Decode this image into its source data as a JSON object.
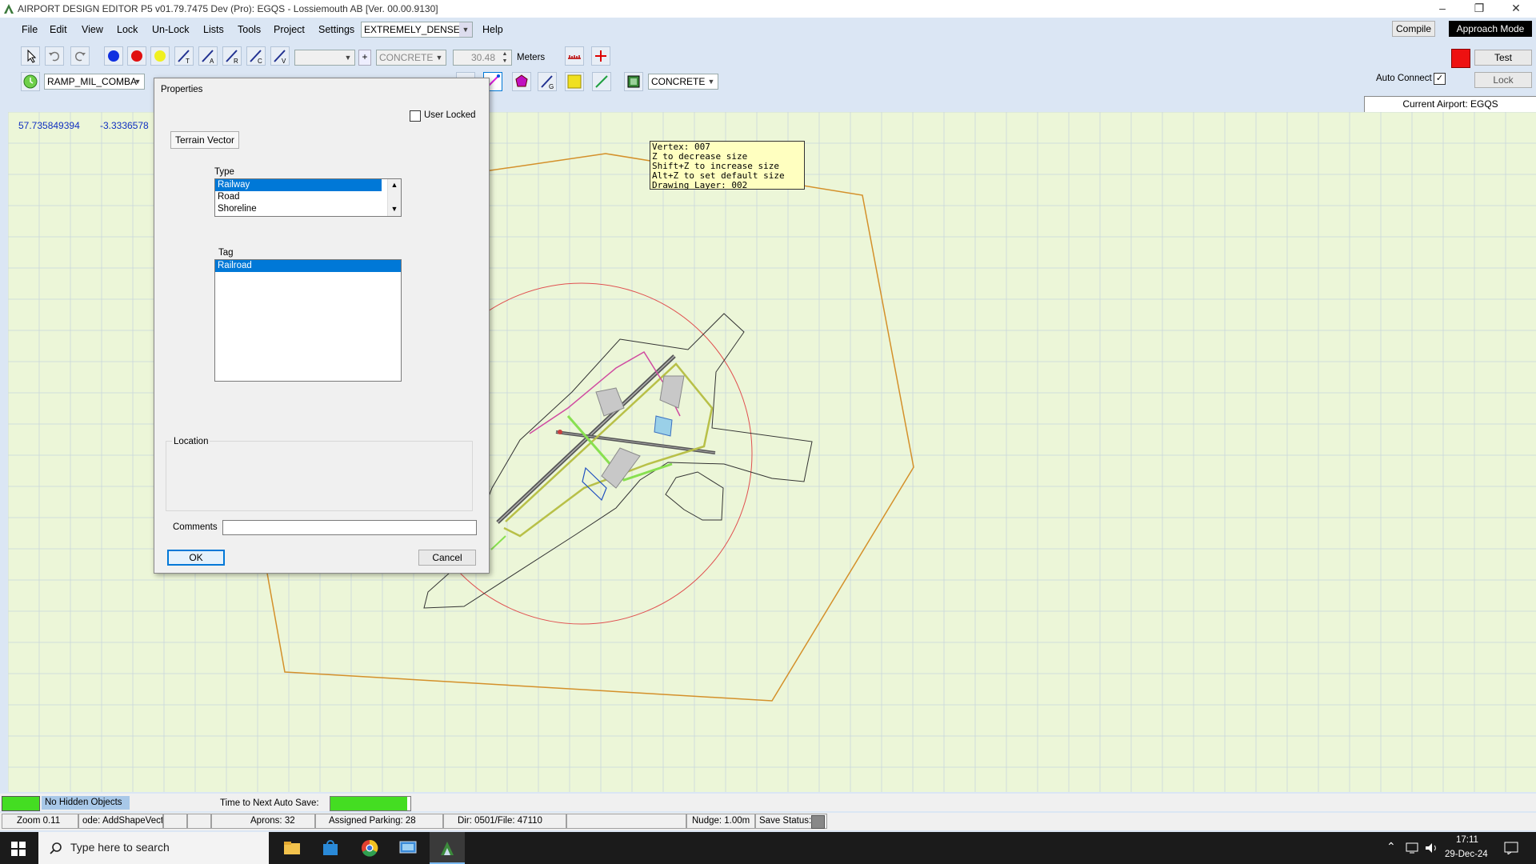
{
  "window": {
    "title": "AIRPORT DESIGN EDITOR P5  v01.79.7475 Dev (Pro): EGQS - Lossiemouth AB [Ver. 00.00.9130]"
  },
  "menu": {
    "items": [
      "File",
      "Edit",
      "View",
      "Lock",
      "Un-Lock",
      "Lists",
      "Tools",
      "Project",
      "Settings"
    ],
    "density": "EXTREMELY_DENSE",
    "help": "Help"
  },
  "toolbar": {
    "surface_top": "CONCRETE",
    "width_value": "30.48",
    "units": "Meters",
    "ramp_select": "RAMP_MIL_COMBA",
    "surface_bottom": "CONCRETE",
    "compile": "Compile",
    "approach_mode": "Approach Mode",
    "test": "Test",
    "auto_connect": "Auto Connect",
    "lock": "Lock",
    "current_airport": "Current Airport: EGQS"
  },
  "coords": {
    "lat": "57.735849394",
    "lon": "-3.3336578"
  },
  "tooltip": {
    "lines": [
      "Vertex: 007",
      "Z to decrease size",
      "Shift+Z to increase size",
      "Alt+Z to set default size",
      "Drawing Layer: 002"
    ]
  },
  "dialog": {
    "title": "Properties",
    "user_locked": "User Locked",
    "object_type": "Terrain Vector",
    "type_label": "Type",
    "type_options": [
      "Railway",
      "Road",
      "Shoreline"
    ],
    "type_selected": "Railway",
    "tag_label": "Tag",
    "tag_options": [
      "Railroad"
    ],
    "tag_selected": "Railroad",
    "location_label": "Location",
    "comments_label": "Comments",
    "comments_value": "",
    "ok": "OK",
    "cancel": "Cancel"
  },
  "status": {
    "hidden_objects": "No Hidden Objects",
    "autosave_label": "Time to Next Auto Save:",
    "zoom": "Zoom 0.11",
    "mode": "ode: AddShapeVect",
    "aprons": "Aprons: 32",
    "assigned_parking": "Assigned Parking: 28",
    "dir_file": "Dir: 0501/File: 47110",
    "nudge": "Nudge: 1.00m",
    "save_status": "Save Status:"
  },
  "taskbar": {
    "search_placeholder": "Type here to search",
    "time": "17:11",
    "date": "29-Dec-24"
  },
  "colors": {
    "canvas": "#ecf6d8",
    "grid": "#c9d6dc",
    "boundary": "#d4902a",
    "radius_circle": "#e05050",
    "selection": "#0078d7",
    "approach_mode_bg": "#000000",
    "status_green": "#44dd22"
  }
}
